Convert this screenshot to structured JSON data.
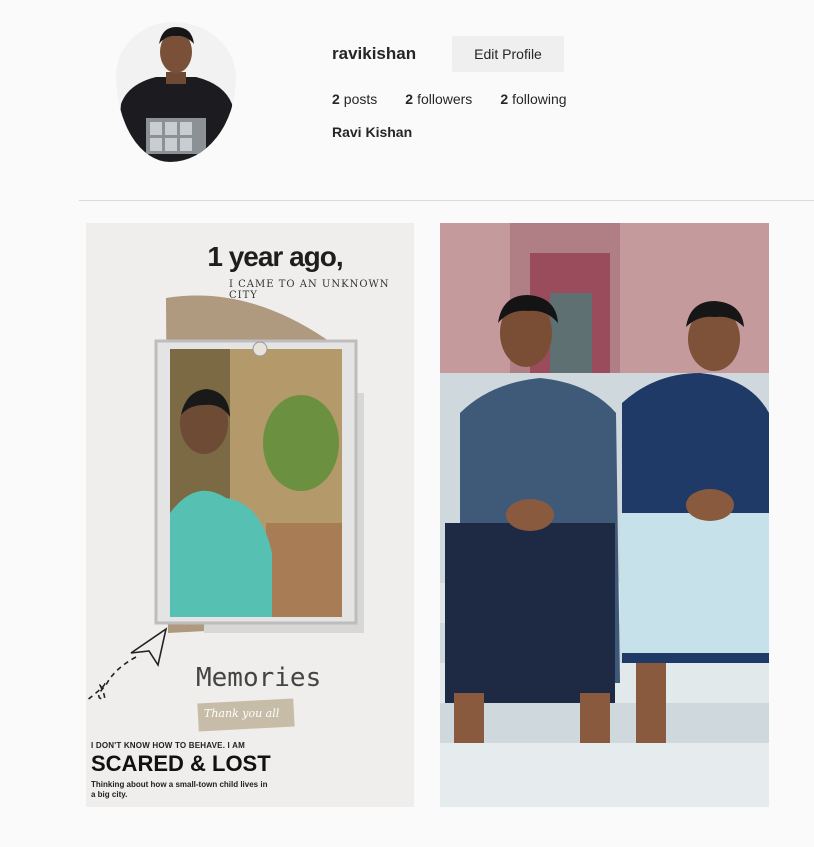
{
  "profile": {
    "username": "ravikishan",
    "edit_label": "Edit Profile",
    "full_name": "Ravi Kishan",
    "stats": {
      "posts_count": "2",
      "posts_label": "posts",
      "followers_count": "2",
      "followers_label": "followers",
      "following_count": "2",
      "following_label": "following"
    }
  },
  "posts": [
    {
      "headline": "1 year ago,",
      "subheadline": "I CAME TO AN UNKNOWN CITY",
      "memories": "Memories",
      "thank_you": "Thank you all",
      "small_text": "I DON'T KNOW HOW TO BEHAVE. I AM",
      "big_text": "SCARED & LOST",
      "caption": "Thinking about how a small-town child lives in a big city."
    },
    {}
  ]
}
